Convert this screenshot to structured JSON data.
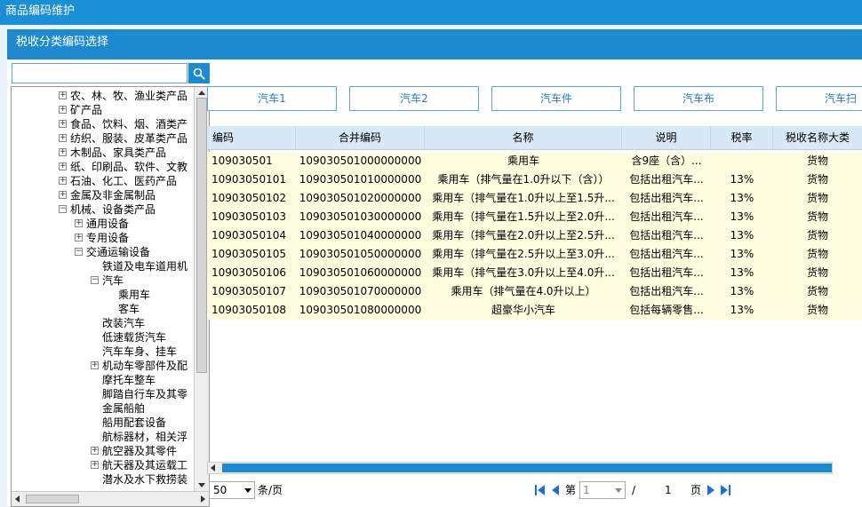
{
  "window_title": "商品编码维护",
  "dialog_title": "税收分类编码选择",
  "search": {
    "value": "",
    "placeholder": ""
  },
  "tree": [
    {
      "label": "农、林、牧、渔业类产品",
      "level": 0,
      "toggle": "+"
    },
    {
      "label": "矿产品",
      "level": 0,
      "toggle": "+"
    },
    {
      "label": "食品、饮料、烟、酒类产",
      "level": 0,
      "toggle": "+"
    },
    {
      "label": "纺织、服装、皮革类产品",
      "level": 0,
      "toggle": "+"
    },
    {
      "label": "木制品、家具类产品",
      "level": 0,
      "toggle": "+"
    },
    {
      "label": "纸、印刷品、软件、文教",
      "level": 0,
      "toggle": "+"
    },
    {
      "label": "石油、化工、医药产品",
      "level": 0,
      "toggle": "+"
    },
    {
      "label": "金属及非金属制品",
      "level": 0,
      "toggle": "+"
    },
    {
      "label": "机械、设备类产品",
      "level": 0,
      "toggle": "-"
    },
    {
      "label": "通用设备",
      "level": 1,
      "toggle": "+"
    },
    {
      "label": "专用设备",
      "level": 1,
      "toggle": "+"
    },
    {
      "label": "交通运输设备",
      "level": 1,
      "toggle": "-"
    },
    {
      "label": "铁道及电车道用机",
      "level": 2,
      "toggle": ""
    },
    {
      "label": "汽车",
      "level": 2,
      "toggle": "-"
    },
    {
      "label": "乘用车",
      "level": 3,
      "toggle": ""
    },
    {
      "label": "客车",
      "level": 3,
      "toggle": ""
    },
    {
      "label": "改装汽车",
      "level": 2,
      "toggle": ""
    },
    {
      "label": "低速载货汽车",
      "level": 2,
      "toggle": ""
    },
    {
      "label": "汽车车身、挂车",
      "level": 2,
      "toggle": ""
    },
    {
      "label": "机动车零部件及配",
      "level": 2,
      "toggle": "+"
    },
    {
      "label": "摩托车整车",
      "level": 2,
      "toggle": ""
    },
    {
      "label": "脚踏自行车及其零",
      "level": 2,
      "toggle": ""
    },
    {
      "label": "金属船舶",
      "level": 2,
      "toggle": ""
    },
    {
      "label": "船用配套设备",
      "level": 2,
      "toggle": ""
    },
    {
      "label": "航标器材，相关浮",
      "level": 2,
      "toggle": ""
    },
    {
      "label": "航空器及其零件",
      "level": 2,
      "toggle": "+"
    },
    {
      "label": "航天器及其运载工",
      "level": 2,
      "toggle": "+"
    },
    {
      "label": "潜水及水下救捞装",
      "level": 2,
      "toggle": ""
    }
  ],
  "tabs": [
    "汽车1",
    "汽车2",
    "汽车件",
    "汽车布",
    "汽车扫"
  ],
  "columns": [
    "编码",
    "合并编码",
    "名称",
    "说明",
    "税率",
    "税收名称大类"
  ],
  "rows": [
    {
      "code": "109030501",
      "merged": "109030501000000000",
      "name": "乘用车",
      "desc": "含9座（含）...",
      "rate": "",
      "category": "货物"
    },
    {
      "code": "10903050101",
      "merged": "109030501010000000",
      "name": "乘用车（排气量在1.0升以下（含））",
      "desc": "包括出租汽车...",
      "rate": "13%",
      "category": "货物"
    },
    {
      "code": "10903050102",
      "merged": "109030501020000000",
      "name": "乘用车（排气量在1.0升以上至1.5升...",
      "desc": "包括出租汽车...",
      "rate": "13%",
      "category": "货物"
    },
    {
      "code": "10903050103",
      "merged": "109030501030000000",
      "name": "乘用车（排气量在1.5升以上至2.0升...",
      "desc": "包括出租汽车...",
      "rate": "13%",
      "category": "货物"
    },
    {
      "code": "10903050104",
      "merged": "109030501040000000",
      "name": "乘用车（排气量在2.0升以上至2.5升...",
      "desc": "包括出租汽车...",
      "rate": "13%",
      "category": "货物"
    },
    {
      "code": "10903050105",
      "merged": "109030501050000000",
      "name": "乘用车（排气量在2.5升以上至3.0升...",
      "desc": "包括出租汽车...",
      "rate": "13%",
      "category": "货物"
    },
    {
      "code": "10903050106",
      "merged": "109030501060000000",
      "name": "乘用车（排气量在3.0升以上至4.0升...",
      "desc": "包括出租汽车...",
      "rate": "13%",
      "category": "货物"
    },
    {
      "code": "10903050107",
      "merged": "109030501070000000",
      "name": "乘用车（排气量在4.0升以上）",
      "desc": "包括出租汽车...",
      "rate": "13%",
      "category": "货物"
    },
    {
      "code": "10903050108",
      "merged": "109030501080000000",
      "name": "超豪华小汽车",
      "desc": "包括每辆零售...",
      "rate": "13%",
      "category": "货物"
    }
  ],
  "pager": {
    "page_size": "50",
    "per_page_suffix": "条/页",
    "page_prefix": "第",
    "current_page": "1",
    "separator": "/",
    "total_pages": "1",
    "page_suffix": "页"
  },
  "colors": {
    "accent": "#1d8ad0",
    "row_bg": "#fffde0",
    "header_bg": "#d7e8f6",
    "tab_text": "#2a7cc7"
  }
}
